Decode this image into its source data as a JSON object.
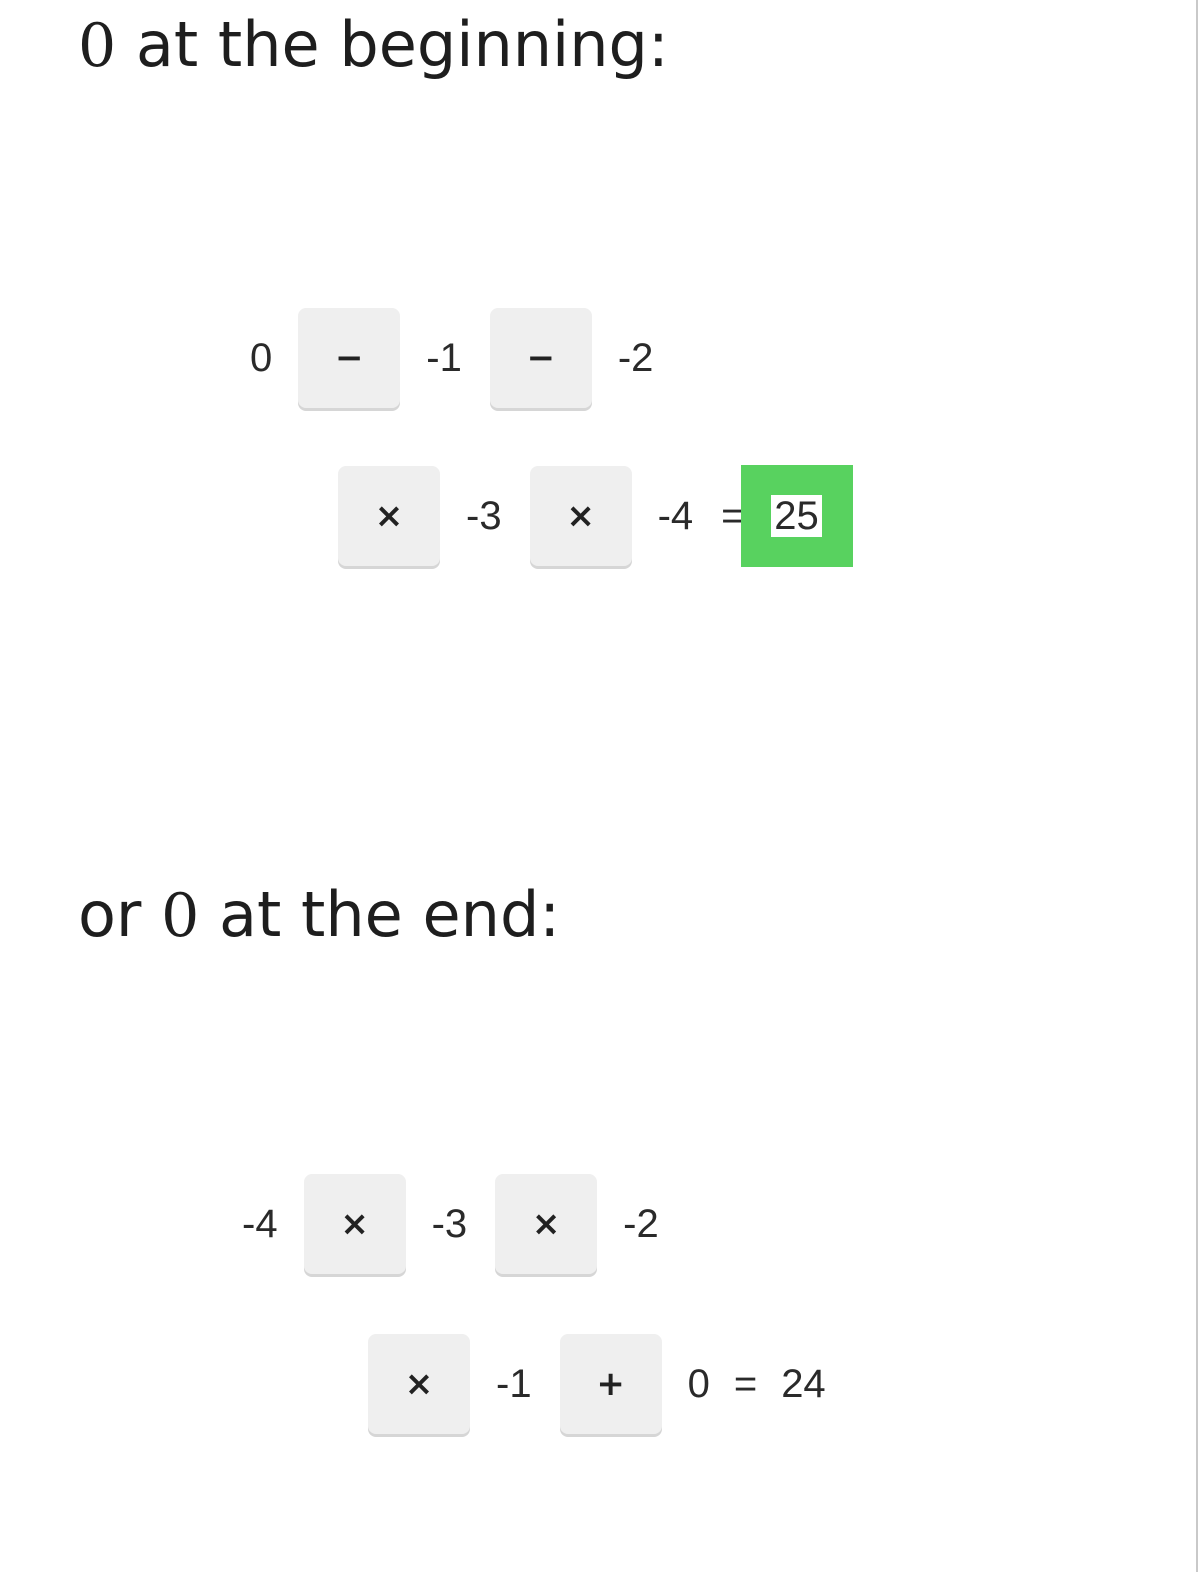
{
  "section_beginning": {
    "heading_zero": "0",
    "heading_text": " at the beginning:",
    "line1": {
      "n0": "0",
      "op1": "−",
      "n1": "-1",
      "op2": "−",
      "n2": "-2"
    },
    "line2": {
      "op3": "×",
      "n3": "-3",
      "op4": "×",
      "n4": "-4",
      "equals": "=",
      "result": "25"
    },
    "result_highlight_color": "#58d25f"
  },
  "section_end": {
    "heading_prefix": "or ",
    "heading_zero": "0",
    "heading_text": " at the end:",
    "line1": {
      "n0": "-4",
      "op1": "×",
      "n1": "-3",
      "op2": "×",
      "n2": "-2"
    },
    "line2": {
      "op3": "×",
      "n3": "-1",
      "op4": "+",
      "n4": "0",
      "equals": "=",
      "result": "24"
    }
  },
  "colors": {
    "operator_button_bg": "#efefef",
    "text": "#1e1e1e"
  }
}
